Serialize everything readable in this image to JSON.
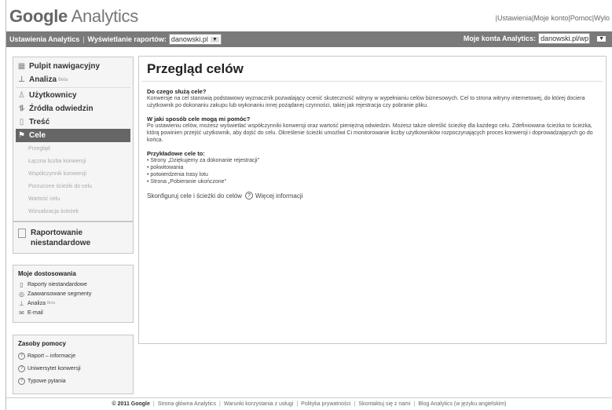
{
  "header": {
    "logo_google": "Google",
    "logo_product": "Analytics",
    "links": [
      "Ustawienia",
      "Moje konto",
      "Pomoc",
      "Wylo"
    ]
  },
  "toolbar": {
    "settings_label": "Ustawienia Analytics",
    "reports_label": "Wyświetlanie raportów:",
    "reports_value": "danowski.pl",
    "accounts_label": "Moje konta Analytics:",
    "accounts_value": "danowski.pl/wp"
  },
  "sidebar": {
    "nav": {
      "dashboard": "Pulpit nawigacyjny",
      "analysis": "Analiza",
      "analysis_badge": "Beta",
      "users": "Użytkownicy",
      "traffic": "Źródła odwiedzin",
      "content": "Treść",
      "goals": "Cele",
      "sub": [
        "Przegląd",
        "Łączna liczba konwersji",
        "Współczynnik konwersji",
        "Porzucone ścieżki do celu",
        "Wartość celu",
        "Wizualizacja ścieżek"
      ]
    },
    "custom_reporting": "Raportowanie niestandardowe",
    "my_custom": {
      "title": "Moje dostosowania",
      "items": [
        "Raporty niestandardowe",
        "Zaawansowane segmenty",
        "Analiza",
        "E-mail"
      ],
      "analysis_badge": "Beta"
    },
    "help": {
      "title": "Zasoby pomocy",
      "items": [
        "Raport – informacje",
        "Uniwersytet konwersji",
        "Typowe pytania"
      ]
    }
  },
  "main": {
    "title": "Przegląd celów",
    "q1": "Do czego służą cele?",
    "a1": "Konwersje na cel stanowią podstawowy wyznacznik pozwalający ocenić skuteczność witryny w wypełnianiu celów biznesowych. Cel to strona witryny internetowej, do której dociera użytkownik po dokonaniu zakupu lub wykonaniu innej pożądanej czynności, takiej jak rejestracja czy pobranie pliku.",
    "q2": "W jaki sposób cele mogą mi pomóc?",
    "a2": "Po ustawieniu celów, możesz wyświetlać współczynniki konwersji oraz wartość pieniężną odwiedzin. Możesz także określić ścieżkę dla każdego celu. Zdefiniowana ścieżka to ścieżka, którą powinien przejść użytkownik, aby dojść do celu. Określenie ścieżki umożliwi Ci monitorowanie liczby użytkowników rozpoczynających proces konwersji i doprowadzających go do końca.",
    "q3": "Przykładowe cele to:",
    "examples": [
      "Strony „Dziękujemy za dokonanie rejestracji\"",
      "pokwitowania",
      "potwierdzenia trasy lotu",
      "Strona „Pobieranie ukończone\""
    ],
    "configure": "Skonfiguruj cele i ścieżki do celów",
    "more_info": "Więcej informacji"
  },
  "footer": {
    "copyright": "© 2011 Google",
    "links": [
      "Strona główna Analytics",
      "Warunki korzystania z usługi",
      "Polityka prywatności",
      "Skontaktuj się z nami",
      "Blog Analytics (w języku angielskim)"
    ]
  },
  "icons": {
    "dashboard": "grid-icon",
    "analysis": "chart-icon",
    "users": "person-icon",
    "traffic": "branch-icon",
    "content": "page-icon",
    "goals": "flag-icon"
  }
}
